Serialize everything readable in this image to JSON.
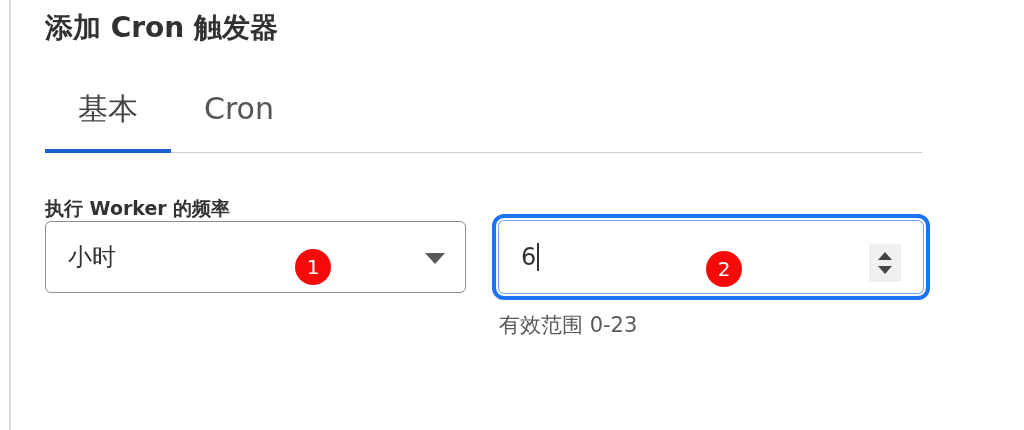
{
  "title": "添加 Cron 触发器",
  "tabs": [
    {
      "label": "基本",
      "selected": true
    },
    {
      "label": "Cron",
      "selected": false
    }
  ],
  "frequency": {
    "label": "执行 Worker 的频率",
    "unit_select": {
      "value": "小时",
      "badge": "1"
    },
    "amount_field": {
      "value": "6",
      "focused": true,
      "badge": "2",
      "hint": "有效范围 0-23"
    }
  }
}
